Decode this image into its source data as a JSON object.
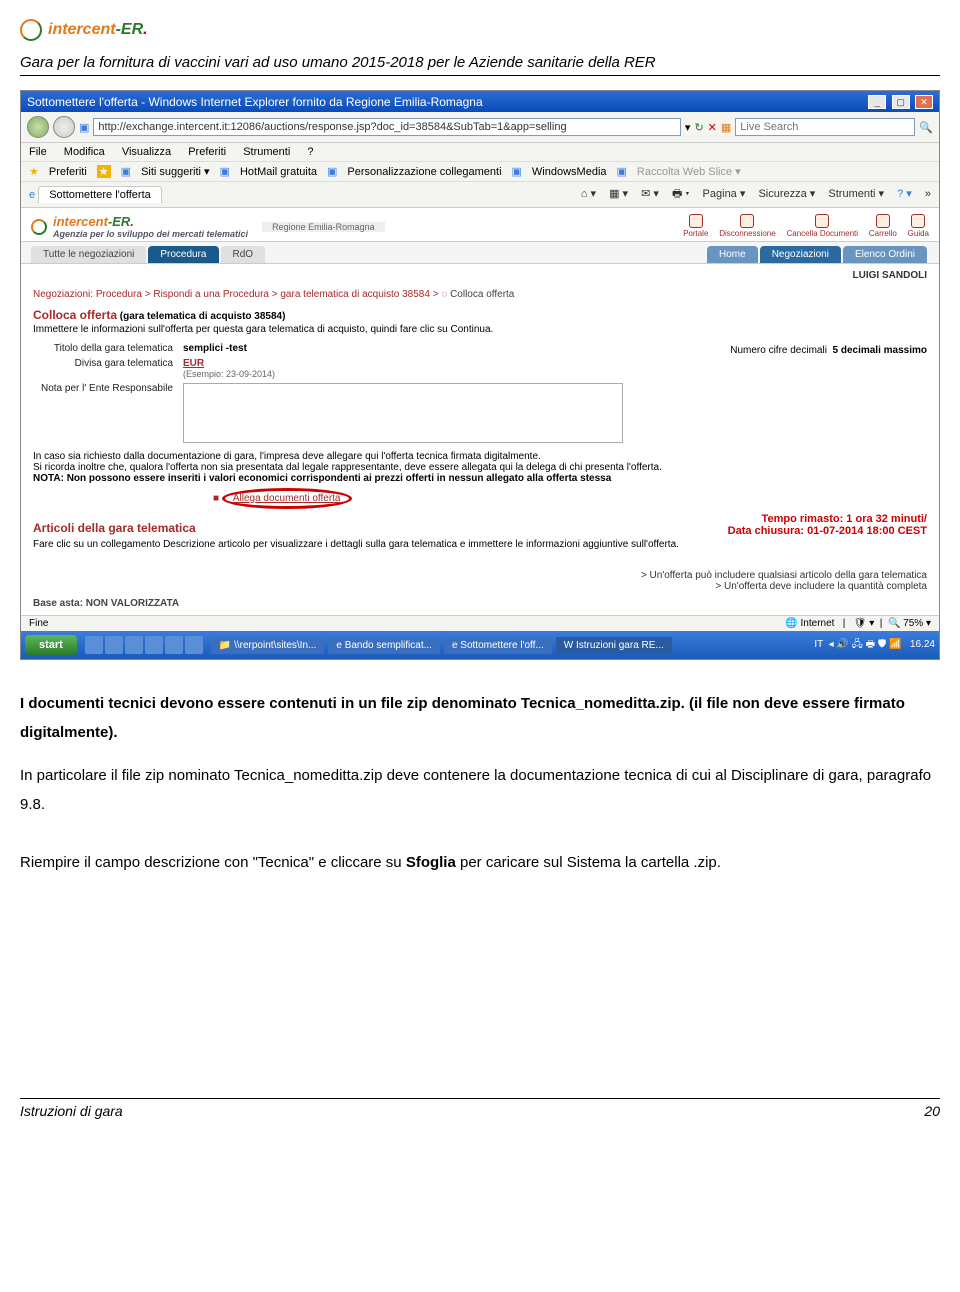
{
  "header": {
    "logo_text_1": "intercent",
    "logo_text_2": "-ER",
    "doc_title": "Gara per la fornitura di vaccini vari ad uso umano 2015-2018 per le Aziende sanitarie della RER"
  },
  "ie": {
    "title": "Sottomettere l'offerta - Windows Internet Explorer fornito da Regione Emilia-Romagna",
    "url": "http://exchange.intercent.it:12086/auctions/response.jsp?doc_id=38584&SubTab=1&app=selling",
    "search_placeholder": "Live Search",
    "menu": [
      "File",
      "Modifica",
      "Visualizza",
      "Preferiti",
      "Strumenti",
      "?"
    ],
    "fav_label": "Preferiti",
    "fav_items": [
      "Siti suggeriti ▾",
      "HotMail gratuita",
      "Personalizzazione collegamenti",
      "WindowsMedia",
      "Raccolta Web Slice ▾"
    ],
    "tab": "Sottomettere l'offerta",
    "toolbar": [
      "Pagina ▾",
      "Sicurezza ▾",
      "Strumenti ▾"
    ],
    "status_left": "Fine",
    "status_zone": "Internet",
    "status_zoom": "75%"
  },
  "app": {
    "sublogo": "Agenzia per lo sviluppo dei mercati telematici",
    "rer": "Regione Emilia-Romagna",
    "top_icons": [
      "Portale",
      "Disconnessione",
      "Cancella Documenti",
      "Carrello",
      "Guida"
    ],
    "left_tabs": [
      "Tutte le negoziazioni",
      "Procedura",
      "RdO"
    ],
    "right_tabs": [
      "Home",
      "Negoziazioni",
      "Elenco Ordini"
    ],
    "user": "LUIGI SANDOLI",
    "breadcrumb": "Negoziazioni: Procedura > Rispondi a una Procedura > gara telematica di acquisto 38584 >",
    "breadcrumb_last": "Colloca offerta",
    "heading": "Colloca offerta",
    "heading_after": "(gara telematica di acquisto 38584)",
    "intro": "Immettere le informazioni sull'offerta per questa gara telematica di acquisto, quindi fare clic su Continua.",
    "titolo_lbl": "Titolo della gara telematica",
    "titolo_val": "semplici -test",
    "divisa_lbl": "Divisa gara telematica",
    "divisa_val": "EUR",
    "divisa_ex": "(Esempio: 23-09-2014)",
    "numero_lbl": "Numero cifre decimali",
    "numero_val": "5 decimali massimo",
    "nota_lbl": "Nota per l' Ente Responsabile",
    "disclaimer1": "In caso sia richiesto dalla documentazione di gara, l'impresa deve allegare qui l'offerta tecnica firmata digitalmente.",
    "disclaimer2": "Si ricorda inoltre che, qualora l'offerta non sia presentata dal legale rappresentante, deve essere allegata qui la delega di chi presenta l'offerta.",
    "disclaimer3": "NOTA: Non possono essere inseriti i valori economici corrispondenti ai prezzi offerti in nessun allegato alla offerta stessa",
    "allega": "Allega documenti offerta",
    "section2": "Articoli della gara telematica",
    "section2_text": "Fare clic su un collegamento Descrizione articolo per visualizzare i dettagli sulla gara telematica e immettere le informazioni aggiuntive sull'offerta.",
    "timer1": "Tempo rimasto: 1 ora 32 minuti/",
    "timer2": "Data chiusura: 01-07-2014 18:00 CEST",
    "hint1": "> Un'offerta può includere qualsiasi articolo della gara telematica",
    "hint2": "> Un'offerta deve includere la quantità completa",
    "base": "Base asta: NON VALORIZZATA"
  },
  "taskbar": {
    "start": "start",
    "tasks": [
      "\\\\rerpoint\\sites\\In...",
      "Bando semplificat...",
      "Sottomettere l'off...",
      "Istruzioni gara RE..."
    ],
    "lang": "IT",
    "time": "16.24"
  },
  "body": {
    "p1a": "I documenti tecnici devono essere contenuti in un file zip denominato Tecnica_nomeditta.zip. (il file non deve essere firmato digitalmente).",
    "p1b": "In particolare il file zip nominato Tecnica_nomeditta.zip deve contenere la documentazione tecnica di cui al Disciplinare di gara, paragrafo 9.8.",
    "p2a": "Riempire il campo descrizione con \"Tecnica\" e cliccare su ",
    "p2b": "Sfoglia",
    "p2c": " per caricare sul Sistema la cartella .zip."
  },
  "footer": {
    "left": "Istruzioni di gara",
    "right": "20"
  }
}
